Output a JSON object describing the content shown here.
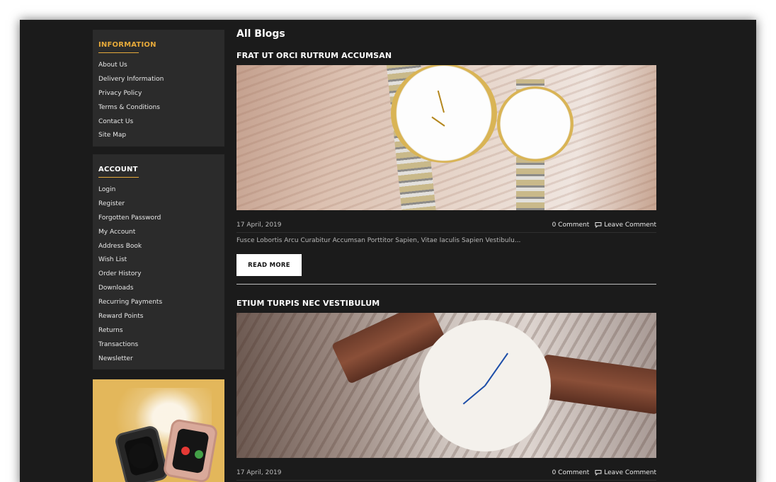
{
  "sidebar": {
    "information": {
      "title": "INFORMATION",
      "items": [
        "About Us",
        "Delivery Information",
        "Privacy Policy",
        "Terms & Conditions",
        "Contact Us",
        "Site Map"
      ]
    },
    "account": {
      "title": "ACCOUNT",
      "items": [
        "Login",
        "Register",
        "Forgotten Password",
        "My Account",
        "Address Book",
        "Wish List",
        "Order History",
        "Downloads",
        "Recurring Payments",
        "Reward Points",
        "Returns",
        "Transactions",
        "Newsletter"
      ]
    }
  },
  "main": {
    "page_title": "All Blogs",
    "posts": [
      {
        "title": "FRAT UT ORCI RUTRUM ACCUMSAN",
        "date": "17 April, 2019",
        "comments": "0 Comment",
        "leave_comment": "Leave Comment",
        "excerpt": "Fusce Lobortis Arcu Curabitur Accumsan Porttitor Sapien, Vitae Iaculis Sapien Vestibulu...",
        "read_more": "READ MORE"
      },
      {
        "title": "ETIUM TURPIS NEC VESTIBULUM",
        "date": "17 April, 2019",
        "comments": "0 Comment",
        "leave_comment": "Leave Comment"
      }
    ]
  },
  "colors": {
    "accent": "#e6a93a",
    "page_background": "#1b1b1b",
    "panel_background": "#2b2b2b"
  },
  "icons": {
    "comment": "comment-bubble-icon"
  }
}
